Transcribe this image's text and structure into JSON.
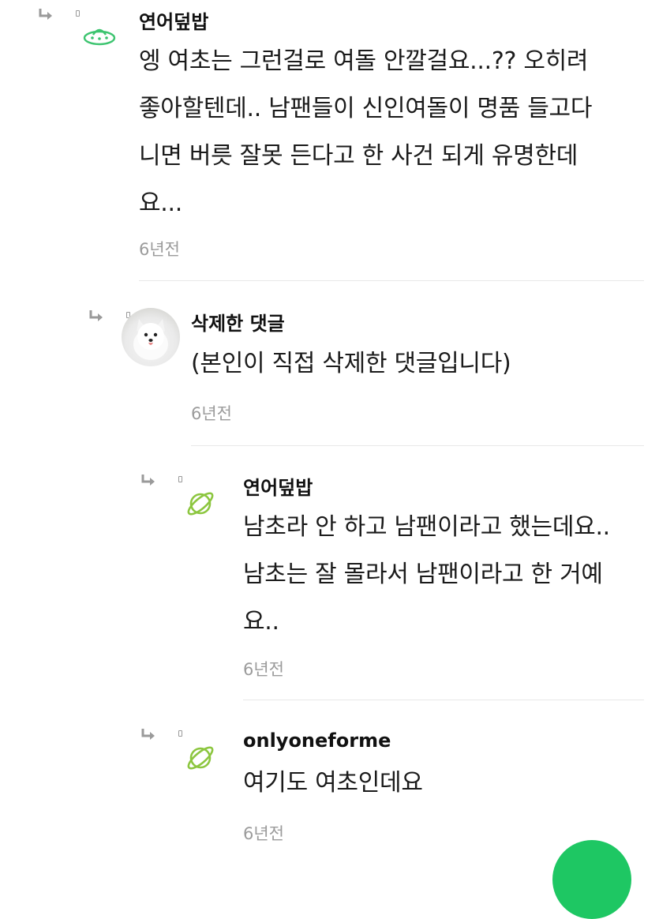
{
  "comments": [
    {
      "nickname": "연어덮밥",
      "lines": [
        "엥 여초는 그런걸로 여돌 안깔걸요...?? 오히려",
        "좋아할텐데.. 남팬들이 신인여돌이 명품 들고다",
        "니면 버릇 잘못 든다고 한 사건 되게 유명한데",
        "요..."
      ],
      "time": "6년전",
      "avatar_icon": "ufo-icon"
    },
    {
      "nickname": "삭제한 댓글",
      "lines": [
        "(본인이 직접 삭제한 댓글입니다)"
      ],
      "time": "6년전",
      "avatar_icon": "dog-photo"
    },
    {
      "nickname": "연어덮밥",
      "lines": [
        "남초라 안 하고 남팬이라고 했는데요..",
        "남초는 잘 몰라서 남팬이라고 한 거예",
        "요.."
      ],
      "time": "6년전",
      "avatar_icon": "planet-icon"
    },
    {
      "nickname": "onlyoneforme",
      "lines": [
        "여기도 여초인데요"
      ],
      "time": "6년전",
      "avatar_icon": "planet-icon"
    }
  ],
  "colors": {
    "icon_green": "#3cc46f",
    "planet_green": "#8cc63f",
    "timestamp_gray": "#9b9b9b",
    "fab_green": "#1ec763"
  },
  "icons": {
    "reply": "reply-arrow-icon",
    "fab": "floating-action-button"
  }
}
